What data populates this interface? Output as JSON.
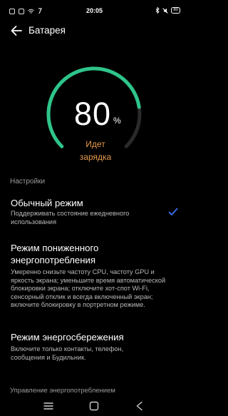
{
  "status_bar": {
    "time": "20:05",
    "battery": "80",
    "left_icons": [
      "notification-icon",
      "notification-icon",
      "wifi-icon",
      "notification-icon"
    ],
    "right_icons": [
      "bluetooth-icon",
      "silent-icon",
      "battery-icon"
    ]
  },
  "header": {
    "title": "Батарея"
  },
  "battery": {
    "percent": "80",
    "percent_sign": "%",
    "status_line1": "Идет",
    "status_line2": "зарядка",
    "level_fraction": 0.8,
    "accent_color": "#2ec48a",
    "track_color": "#2a2a2a",
    "status_color": "#e59a4a"
  },
  "settings": {
    "section_label": "Настройки",
    "modes": [
      {
        "title": "Обычный режим",
        "description": "Поддерживать состояние ежедневного использования",
        "selected": true
      },
      {
        "title": "Режим пониженного энергопотребления",
        "description": "Умеренно снизьте частоту CPU, частоту GPU и яркость экрана; уменьшите время автоматической блокировки экрана; отключите хот-спот Wi-Fi, сенсорный отклик и всегда включенный экран; включите блокировку в портретном режиме.",
        "selected": false
      },
      {
        "title": "Режим энергосбережения",
        "description": "Включите только контакты, телефон, сообщения и Будильник.",
        "selected": false
      }
    ],
    "check_color": "#3b6df0"
  },
  "power_management": {
    "label": "Управление энергопотреблением"
  },
  "nav_bar": {
    "icons": [
      "menu-icon",
      "home-icon",
      "back-icon"
    ]
  }
}
